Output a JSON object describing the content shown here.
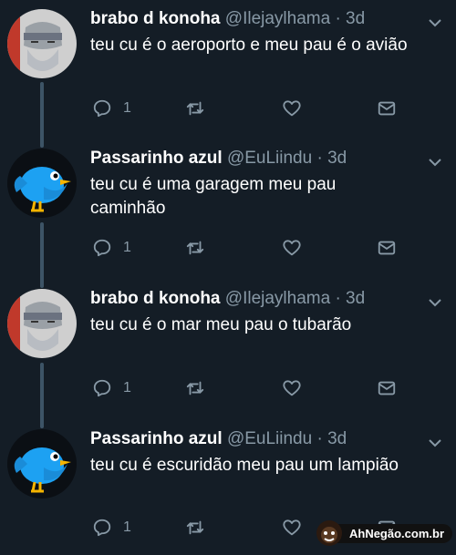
{
  "tweets": [
    {
      "name": "brabo d konoha",
      "handle": "@Ilejaylhama · 3d",
      "text": "teu cu é o aeroporto e meu pau é o avião",
      "replies": "1",
      "avatar": "ninja-avatar"
    },
    {
      "name": "Passarinho azul",
      "handle": "@EuLiindu · 3d",
      "text": "teu cu é uma garagem meu pau caminhão",
      "replies": "1",
      "avatar": "blue-bird-avatar"
    },
    {
      "name": "brabo d konoha",
      "handle": "@Ilejaylhama · 3d",
      "text": "teu cu é o mar meu pau o tubarão",
      "replies": "1",
      "avatar": "ninja-avatar"
    },
    {
      "name": "Passarinho azul",
      "handle": "@EuLiindu · 3d",
      "text": "teu cu é escuridão meu pau um lampião",
      "replies": "1",
      "avatar": "blue-bird-avatar"
    }
  ],
  "watermark": {
    "text": "AhNegão.com.br"
  },
  "colors": {
    "background": "#141d26",
    "secondary_text": "#8899a6",
    "thread_line": "#3d5466",
    "bird_blue": "#1da1f2"
  }
}
